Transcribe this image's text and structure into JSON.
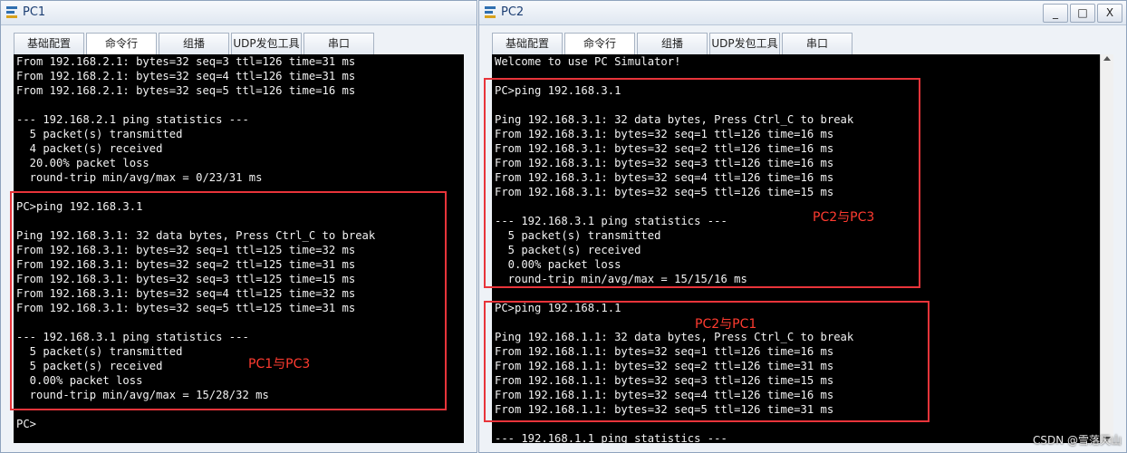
{
  "pc1": {
    "title": "PC1",
    "tabs": [
      "基础配置",
      "命令行",
      "组播",
      "UDP发包工具",
      "串口"
    ],
    "active_tab": 1,
    "console_lines": [
      "From 192.168.2.1: bytes=32 seq=3 ttl=126 time=31 ms",
      "From 192.168.2.1: bytes=32 seq=4 ttl=126 time=31 ms",
      "From 192.168.2.1: bytes=32 seq=5 ttl=126 time=16 ms",
      "",
      "--- 192.168.2.1 ping statistics ---",
      "  5 packet(s) transmitted",
      "  4 packet(s) received",
      "  20.00% packet loss",
      "  round-trip min/avg/max = 0/23/31 ms",
      "",
      "PC>ping 192.168.3.1",
      "",
      "Ping 192.168.3.1: 32 data bytes, Press Ctrl_C to break",
      "From 192.168.3.1: bytes=32 seq=1 ttl=125 time=32 ms",
      "From 192.168.3.1: bytes=32 seq=2 ttl=125 time=31 ms",
      "From 192.168.3.1: bytes=32 seq=3 ttl=125 time=15 ms",
      "From 192.168.3.1: bytes=32 seq=4 ttl=125 time=32 ms",
      "From 192.168.3.1: bytes=32 seq=5 ttl=125 time=31 ms",
      "",
      "--- 192.168.3.1 ping statistics ---",
      "  5 packet(s) transmitted",
      "  5 packet(s) received",
      "  0.00% packet loss",
      "  round-trip min/avg/max = 15/28/32 ms",
      "",
      "PC>"
    ],
    "annotation": "PC1与PC3"
  },
  "pc2": {
    "title": "PC2",
    "window_buttons": [
      "_",
      "□",
      "X"
    ],
    "tabs": [
      "基础配置",
      "命令行",
      "组播",
      "UDP发包工具",
      "串口"
    ],
    "active_tab": 1,
    "console_lines": [
      "Welcome to use PC Simulator!",
      "",
      "PC>ping 192.168.3.1",
      "",
      "Ping 192.168.3.1: 32 data bytes, Press Ctrl_C to break",
      "From 192.168.3.1: bytes=32 seq=1 ttl=126 time=16 ms",
      "From 192.168.3.1: bytes=32 seq=2 ttl=126 time=16 ms",
      "From 192.168.3.1: bytes=32 seq=3 ttl=126 time=16 ms",
      "From 192.168.3.1: bytes=32 seq=4 ttl=126 time=16 ms",
      "From 192.168.3.1: bytes=32 seq=5 ttl=126 time=15 ms",
      "",
      "--- 192.168.3.1 ping statistics ---",
      "  5 packet(s) transmitted",
      "  5 packet(s) received",
      "  0.00% packet loss",
      "  round-trip min/avg/max = 15/15/16 ms",
      "",
      "PC>ping 192.168.1.1",
      "",
      "Ping 192.168.1.1: 32 data bytes, Press Ctrl_C to break",
      "From 192.168.1.1: bytes=32 seq=1 ttl=126 time=16 ms",
      "From 192.168.1.1: bytes=32 seq=2 ttl=126 time=31 ms",
      "From 192.168.1.1: bytes=32 seq=3 ttl=126 time=15 ms",
      "From 192.168.1.1: bytes=32 seq=4 ttl=126 time=16 ms",
      "From 192.168.1.1: bytes=32 seq=5 ttl=126 time=31 ms",
      "",
      "--- 192.168.1.1 ping statistics ---"
    ],
    "annotation_top": "PC2与PC3",
    "annotation_bottom": "PC2与PC1"
  },
  "watermark": "CSDN @雪落天山"
}
